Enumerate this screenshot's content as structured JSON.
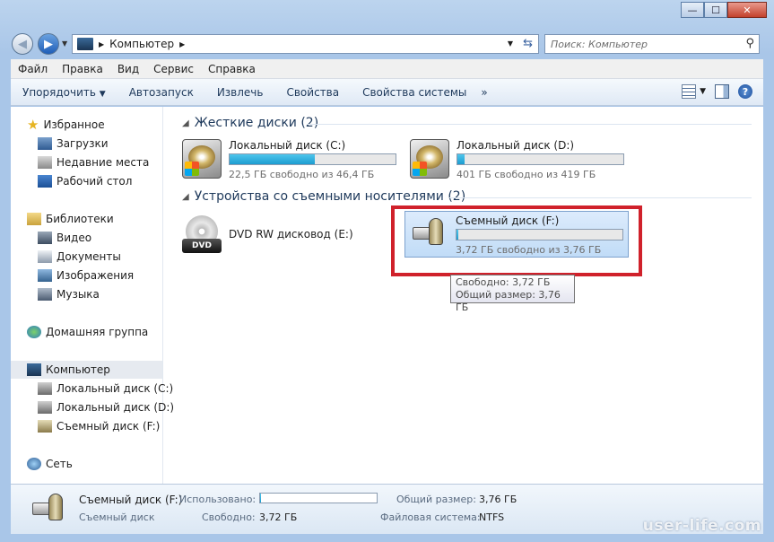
{
  "window": {
    "caption_buttons": {
      "minimize": "—",
      "maximize": "☐",
      "close": "✕"
    }
  },
  "nav": {
    "back_icon": "◀",
    "forward_icon": "▶",
    "breadcrumb": "Компьютер",
    "search_placeholder": "Поиск: Компьютер"
  },
  "menu": [
    "Файл",
    "Правка",
    "Вид",
    "Сервис",
    "Справка"
  ],
  "commands": {
    "organize": "Упорядочить",
    "autoplay": "Автозапуск",
    "eject": "Извлечь",
    "properties": "Свойства",
    "system_properties": "Свойства системы",
    "more": "»"
  },
  "sidebar": {
    "favorites": "Избранное",
    "downloads": "Загрузки",
    "recent": "Недавние места",
    "desktop": "Рабочий стол",
    "libraries": "Библиотеки",
    "video": "Видео",
    "documents": "Документы",
    "images": "Изображения",
    "music": "Музыка",
    "homegroup": "Домашняя группа",
    "computer": "Компьютер",
    "drive_c": "Локальный диск (C:)",
    "drive_d": "Локальный диск (D:)",
    "drive_f": "Съемный диск (F:)",
    "network": "Сеть"
  },
  "groups": {
    "hard_disks": "Жесткие диски (2)",
    "removable": "Устройства со съемными носителями (2)"
  },
  "drives": {
    "c": {
      "name": "Локальный диск (C:)",
      "free": "22,5 ГБ свободно из 46,4 ГБ",
      "used_fraction": 0.515
    },
    "d": {
      "name": "Локальный диск (D:)",
      "free": "401 ГБ свободно из 419 ГБ",
      "used_fraction": 0.043
    },
    "e": {
      "name": "DVD RW дисковод (E:)",
      "label": "DVD"
    },
    "f": {
      "name": "Съемный диск (F:)",
      "free": "3,72 ГБ свободно из 3,76 ГБ",
      "used_fraction": 0.011
    }
  },
  "tooltip": {
    "line1": "Свободно: 3,72 ГБ",
    "line2": "Общий размер: 3,76 ГБ"
  },
  "details": {
    "name": "Съемный диск (F:)",
    "type": "Съемный диск",
    "used_label": "Использовано:",
    "free_label": "Свободно:",
    "free_value": "3,72 ГБ",
    "total_label": "Общий размер:",
    "total_value": "3,76 ГБ",
    "fs_label": "Файловая система:",
    "fs_value": "NTFS",
    "used_fraction": 0.011
  },
  "watermark": "user-life.com",
  "colors": {
    "highlight_box": "#d0212b",
    "progress": "#1d9cd0"
  }
}
